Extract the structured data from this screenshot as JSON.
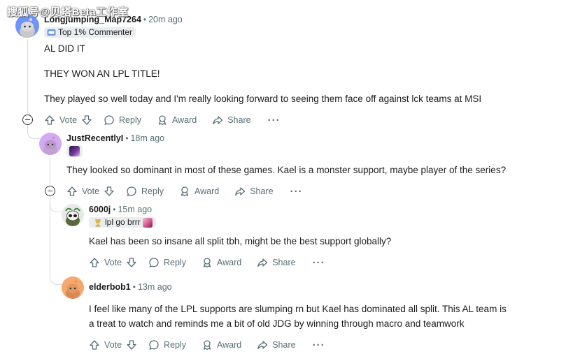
{
  "watermark": "搜狐号@贝塔Beta工作室",
  "comments": [
    {
      "username": "Longjumping_Map7264",
      "time": "20m ago",
      "flair": "Top 1% Commenter",
      "body": [
        "AL DID IT",
        "THEY WON AN LPL TITLE!",
        "They played so well today and I'm really looking forward to seeing them face off against lck teams at MSI"
      ],
      "avatar_color": "#7193ff"
    },
    {
      "username": "JustRecentlyI",
      "time": "18m ago",
      "body": [
        "They looked so dominant in most of these games. Kael is a monster support, maybe player of the series?"
      ],
      "avatar_color": "#d4a8f5"
    },
    {
      "username": "6000j",
      "time": "15m ago",
      "flair": "lpl go brrr",
      "body": [
        "Kael has been so insane all split tbh, might be the best support globally?"
      ],
      "avatar_color": "#e8e8e8"
    },
    {
      "username": "elderbob1",
      "time": "13m ago",
      "body": [
        "I feel like many of the LPL supports are slumping rn but Kael has dominated all split. This AL team is",
        "a treat to watch and reminds me a bit of old JDG by winning through macro and teamwork"
      ],
      "avatar_color": "#f6a86e"
    }
  ],
  "actions": {
    "vote": "Vote",
    "reply": "Reply",
    "award": "Award",
    "share": "Share",
    "more": "···"
  }
}
